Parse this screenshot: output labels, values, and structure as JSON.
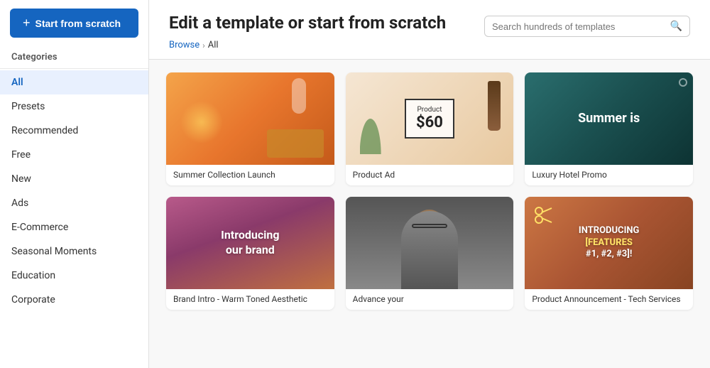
{
  "sidebar": {
    "start_button_label": "Start from scratch",
    "categories_label": "Categories",
    "items": [
      {
        "id": "all",
        "label": "All",
        "active": true
      },
      {
        "id": "presets",
        "label": "Presets",
        "active": false
      },
      {
        "id": "recommended",
        "label": "Recommended",
        "active": false
      },
      {
        "id": "free",
        "label": "Free",
        "active": false
      },
      {
        "id": "new",
        "label": "New",
        "active": false
      },
      {
        "id": "ads",
        "label": "Ads",
        "active": false
      },
      {
        "id": "ecommerce",
        "label": "E-Commerce",
        "active": false
      },
      {
        "id": "seasonal",
        "label": "Seasonal Moments",
        "active": false
      },
      {
        "id": "education",
        "label": "Education",
        "active": false
      },
      {
        "id": "corporate",
        "label": "Corporate",
        "active": false
      }
    ]
  },
  "header": {
    "title": "Edit a template or start from scratch",
    "breadcrumb_browse": "Browse",
    "breadcrumb_chevron": "›",
    "breadcrumb_current": "All",
    "search_placeholder": "Search hundreds of templates"
  },
  "templates": [
    {
      "id": "summer",
      "label": "Summer Collection Launch",
      "thumb_type": "summer"
    },
    {
      "id": "product",
      "label": "Product Ad",
      "thumb_type": "product"
    },
    {
      "id": "hotel",
      "label": "Luxury Hotel Promo",
      "thumb_type": "hotel"
    },
    {
      "id": "brand",
      "label": "Brand Intro - Warm Toned Aesthetic",
      "thumb_type": "brand"
    },
    {
      "id": "person",
      "label": "Advance your",
      "thumb_type": "person"
    },
    {
      "id": "features",
      "label": "Product Announcement - Tech Services",
      "thumb_type": "features"
    }
  ]
}
